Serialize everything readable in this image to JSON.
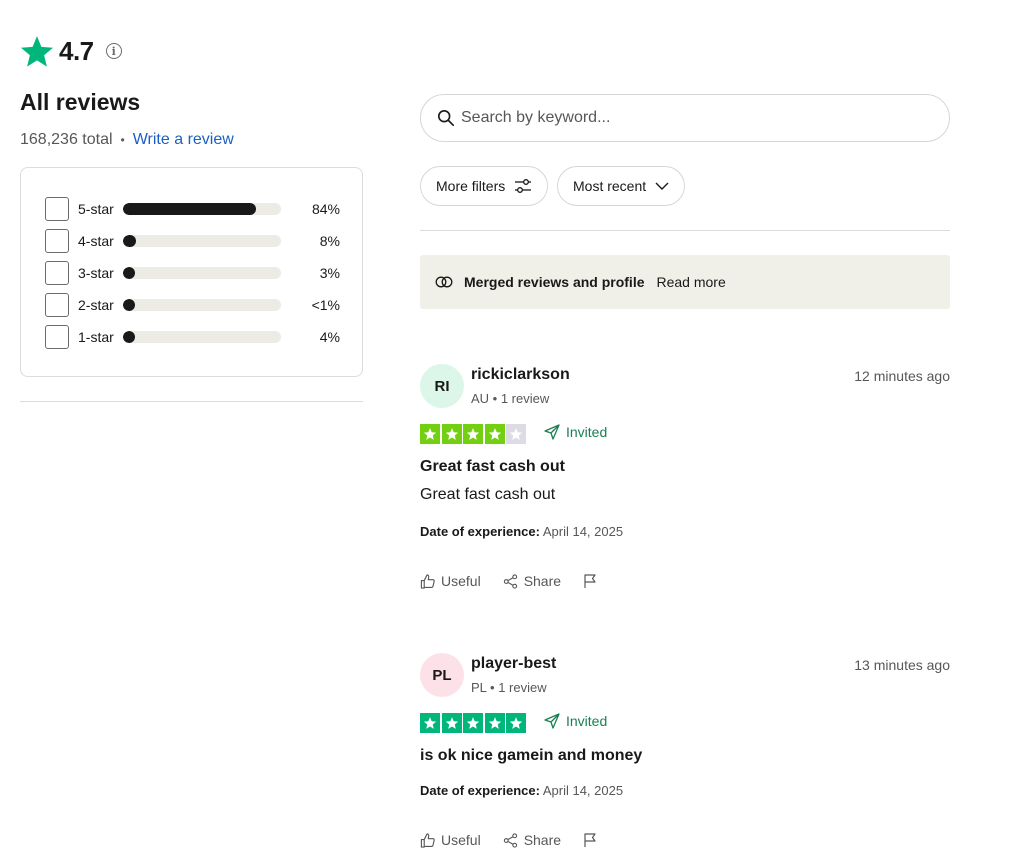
{
  "summary": {
    "rating": "4.7",
    "info_icon": "info-icon",
    "heading": "All reviews",
    "total": "168,236 total",
    "separator": "•",
    "write_review": "Write a review",
    "brand_color": "#00b67a"
  },
  "distribution": [
    {
      "label": "5-star",
      "percent_text": "84%",
      "fill": 0.84
    },
    {
      "label": "4-star",
      "percent_text": "8%",
      "fill": 0.08
    },
    {
      "label": "3-star",
      "percent_text": "3%",
      "fill": 0.03
    },
    {
      "label": "2-star",
      "percent_text": "<1%",
      "fill": 0.01
    },
    {
      "label": "1-star",
      "percent_text": "4%",
      "fill": 0.04
    }
  ],
  "search": {
    "placeholder": "Search by keyword...",
    "value": ""
  },
  "filters": {
    "more_filters": "More filters",
    "sort": "Most recent"
  },
  "merged_notice": {
    "text": "Merged reviews and profile",
    "read_more": "Read more"
  },
  "reviews": [
    {
      "initials": "RI",
      "avatar_color": "#dcf7e9",
      "username": "rickiclarkson",
      "meta": "AU • 1 review",
      "time": "12 minutes ago",
      "stars": 4,
      "star_color": "#73cf11",
      "invited": "Invited",
      "title": "Great fast cash out",
      "body": "Great fast cash out",
      "doe_label": "Date of experience:",
      "doe_value": "April 14, 2025",
      "useful": "Useful",
      "share": "Share"
    },
    {
      "initials": "PL",
      "avatar_color": "#fde1e8",
      "username": "player-best",
      "meta": "PL • 1 review",
      "time": "13 minutes ago",
      "stars": 5,
      "star_color": "#00b67a",
      "invited": "Invited",
      "title": "is ok nice gamein and money",
      "body": "",
      "doe_label": "Date of experience:",
      "doe_value": "April 14, 2025",
      "useful": "Useful",
      "share": "Share"
    }
  ]
}
